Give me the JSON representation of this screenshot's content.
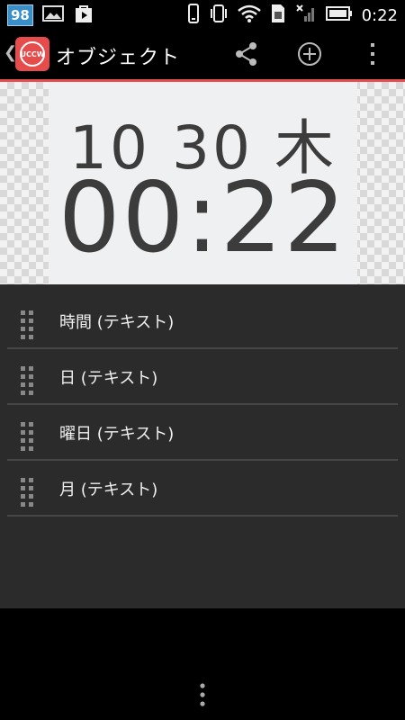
{
  "status_bar": {
    "notification_badge": "98",
    "time": "0:22",
    "icons": [
      "image-icon",
      "play-store-icon",
      "phone-icon",
      "vibrate-icon",
      "wifi-icon",
      "sim-icon",
      "signal-icon",
      "battery-icon"
    ]
  },
  "action_bar": {
    "title": "オブジェクト",
    "app_icon_label": "UCCW",
    "accent_color": "#e74c4c"
  },
  "widget_preview": {
    "date_line": "10 30 木",
    "time_line": "00:22"
  },
  "object_list": {
    "items": [
      {
        "label": "時間 (テキスト)"
      },
      {
        "label": "日 (テキスト)"
      },
      {
        "label": "曜日 (テキスト)"
      },
      {
        "label": "月 (テキスト)"
      }
    ]
  }
}
